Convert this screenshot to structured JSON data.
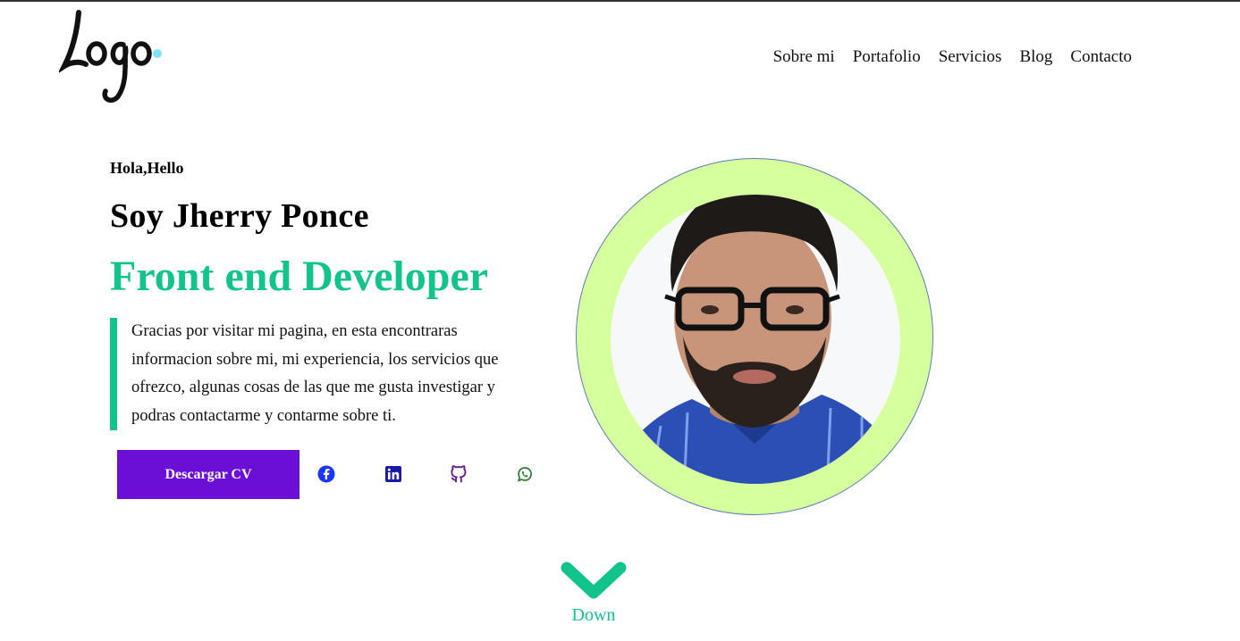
{
  "header": {
    "logo_text": "Logo",
    "nav": [
      "Sobre mi",
      "Portafolio",
      "Servicios",
      "Blog",
      "Contacto"
    ]
  },
  "hero": {
    "greeting": "Hola,Hello",
    "name": "Soy Jherry Ponce",
    "role": "Front end Developer",
    "bio": "Gracias por visitar mi pagina, en esta encontraras informacion sobre mi, mi experiencia, los servicios que ofrezco, algunas cosas de las que me gusta investigar y podras contactarme y contarme sobre ti.",
    "cv_button": "Descargar CV",
    "social": [
      {
        "icon": "facebook-icon",
        "color": "#1a37ff"
      },
      {
        "icon": "linkedin-icon",
        "color": "#1a1aaa"
      },
      {
        "icon": "github-icon",
        "color": "#6a1b8a"
      },
      {
        "icon": "whatsapp-icon",
        "color": "#2e7d32"
      }
    ]
  },
  "scroll": {
    "label": "Down",
    "icon": "chevron-down-icon"
  },
  "colors": {
    "accent_green": "#12c48c",
    "button_purple": "#6b0fd6",
    "photo_ring": "#d6ff9e",
    "logo_dot": "#7fe3f5"
  }
}
